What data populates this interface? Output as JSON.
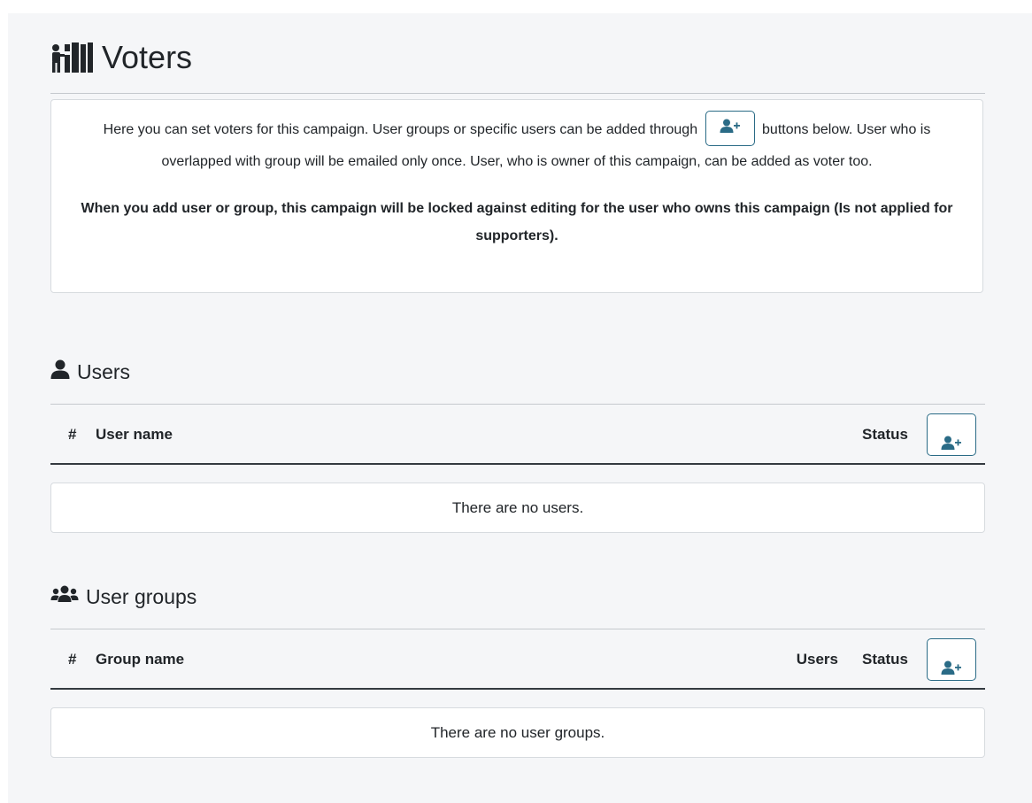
{
  "page": {
    "title": "Voters",
    "title_icon": "voting-people-icon"
  },
  "info": {
    "text_before": "Here you can set voters for this campaign. User groups or specific users can be added through",
    "text_after": "buttons below. User who is overlapped with group will be emailed only once. User, who is owner of this campaign, can be added as voter too.",
    "bold_text": "When you add user or group, this campaign will be locked against editing for the user who owns this campaign (Is not applied for supporters).",
    "button_icon": "user-plus-icon"
  },
  "users": {
    "heading": "Users",
    "heading_icon": "user-icon",
    "columns": {
      "number": "#",
      "name": "User name",
      "status": "Status"
    },
    "add_button_icon": "user-plus-icon",
    "empty_text": "There are no users."
  },
  "groups": {
    "heading": "User groups",
    "heading_icon": "users-icon",
    "columns": {
      "number": "#",
      "name": "Group name",
      "users": "Users",
      "status": "Status"
    },
    "add_button_icon": "user-plus-icon",
    "empty_text": "There are no user groups."
  },
  "colors": {
    "accent": "#2a6b86",
    "text": "#212529",
    "panel": "#f5f6f8"
  }
}
